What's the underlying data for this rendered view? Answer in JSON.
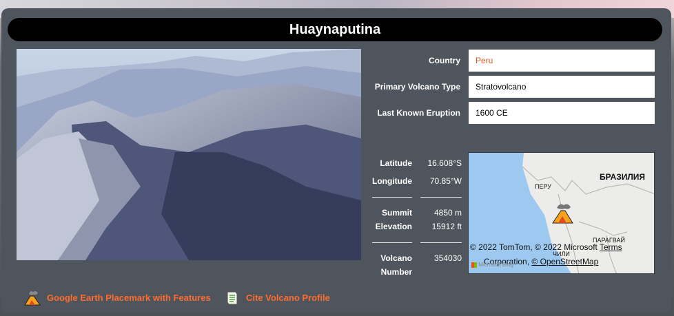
{
  "title": "Huaynaputina",
  "details": {
    "country_label": "Country",
    "country_value": "Peru",
    "type_label": "Primary Volcano Type",
    "type_value": "Stratovolcano",
    "eruption_label": "Last Known Eruption",
    "eruption_value": "1600 CE"
  },
  "coords": {
    "latitude_label": "Latitude",
    "latitude_value": "16.608°S",
    "longitude_label": "Longitude",
    "longitude_value": "70.85°W",
    "summit_label_1": "Summit",
    "summit_label_2": "Elevation",
    "summit_m": "4850 m",
    "summit_ft": "15912 ft",
    "number_label_1": "Volcano",
    "number_label_2": "Number",
    "number_value": "354030"
  },
  "map": {
    "label_brazil": "БРАЗИЛИЯ",
    "label_peru": "ПЕРУ",
    "label_paraguay": "ПАРАГВАЙ",
    "label_chile": "ЧИЛИ",
    "attribution_1": "© 2022 TomTom, © 2022 Microsoft",
    "terms": "Terms",
    "attribution_2": "Corporation,",
    "osm": "© OpenStreetMap",
    "bing": "Microsoft Bing"
  },
  "footer": {
    "earth_link": "Google Earth Placemark with Features",
    "cite_link": "Cite Volcano Profile"
  },
  "colors": {
    "accent": "#ff6b2e",
    "panel": "#4f555c",
    "link_value": "#e0541f"
  }
}
